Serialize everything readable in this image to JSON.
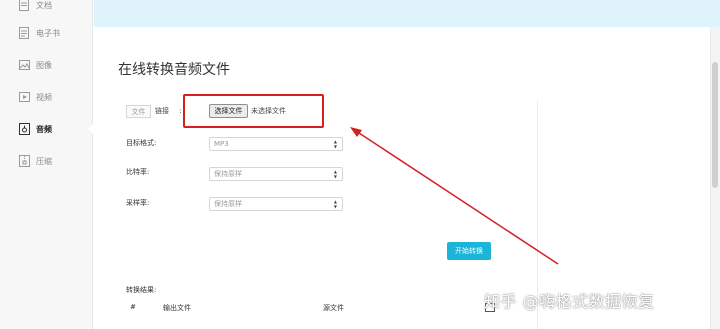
{
  "sidebar": {
    "items": [
      {
        "label": "文档",
        "icon": "document-icon",
        "active": false
      },
      {
        "label": "电子书",
        "icon": "ebook-icon",
        "active": false
      },
      {
        "label": "图像",
        "icon": "image-icon",
        "active": false
      },
      {
        "label": "视频",
        "icon": "video-icon",
        "active": false
      },
      {
        "label": "音频",
        "icon": "audio-icon",
        "active": true
      },
      {
        "label": "压缩",
        "icon": "archive-icon",
        "active": false
      }
    ]
  },
  "main": {
    "title": "在线转换音频文件",
    "source": {
      "tab_file": "文件",
      "tab_link": "链接",
      "separator": ":",
      "choose_button": "选择文件",
      "file_status": "未选择文件"
    },
    "form": {
      "format_label": "目标格式:",
      "format_value": "MP3",
      "bitrate_label": "比特率:",
      "bitrate_value": "保持原样",
      "samplerate_label": "采样率:",
      "samplerate_value": "保持原样"
    },
    "start_button": "开始转换",
    "results": {
      "label": "转换结果:",
      "columns": [
        "#",
        "输出文件",
        "源文件"
      ]
    }
  },
  "annotation": {
    "color": "#d5201e"
  },
  "watermark": "知乎 @嗨格式数据恢复",
  "colors": {
    "accent": "#1cb4d8",
    "banner": "#dff3fa",
    "annotation": "#d5201e"
  }
}
